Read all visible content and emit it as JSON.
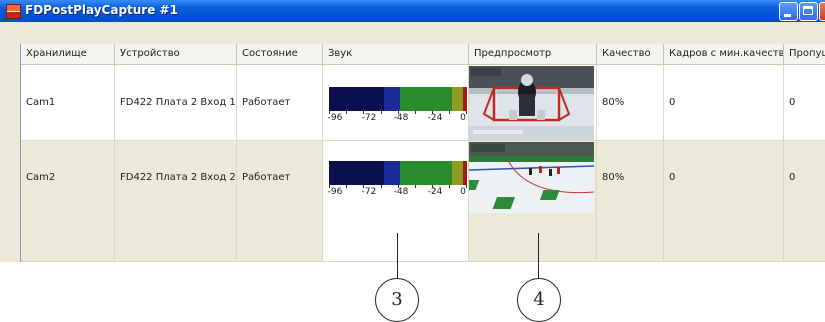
{
  "window": {
    "title": "FDPostPlayCapture #1"
  },
  "table": {
    "columns": [
      "Хранилище",
      "Устройство",
      "Состояние",
      "Звук",
      "Предпросмотр",
      "Качество",
      "Кадров с мин.качеством",
      "Пропуще"
    ],
    "rows": [
      {
        "storage": "Cam1",
        "device": "FD422 Плата 2 Вход 1",
        "state": "Работает",
        "quality": "80%",
        "min_quality_frames": "0",
        "skipped": "0"
      },
      {
        "storage": "Cam2",
        "device": "FD422 Плата 2 Вход 2",
        "state": "Работает",
        "quality": "80%",
        "min_quality_frames": "0",
        "skipped": "0"
      }
    ],
    "sound_scale": [
      "-96",
      "-72",
      "-48",
      "-24",
      "0"
    ],
    "sound_level_colors": [
      "#0c0f4e",
      "#1b2a97",
      "#2a8c2a",
      "#8f9c22",
      "#a81818"
    ]
  },
  "callouts": [
    "3",
    "4"
  ]
}
